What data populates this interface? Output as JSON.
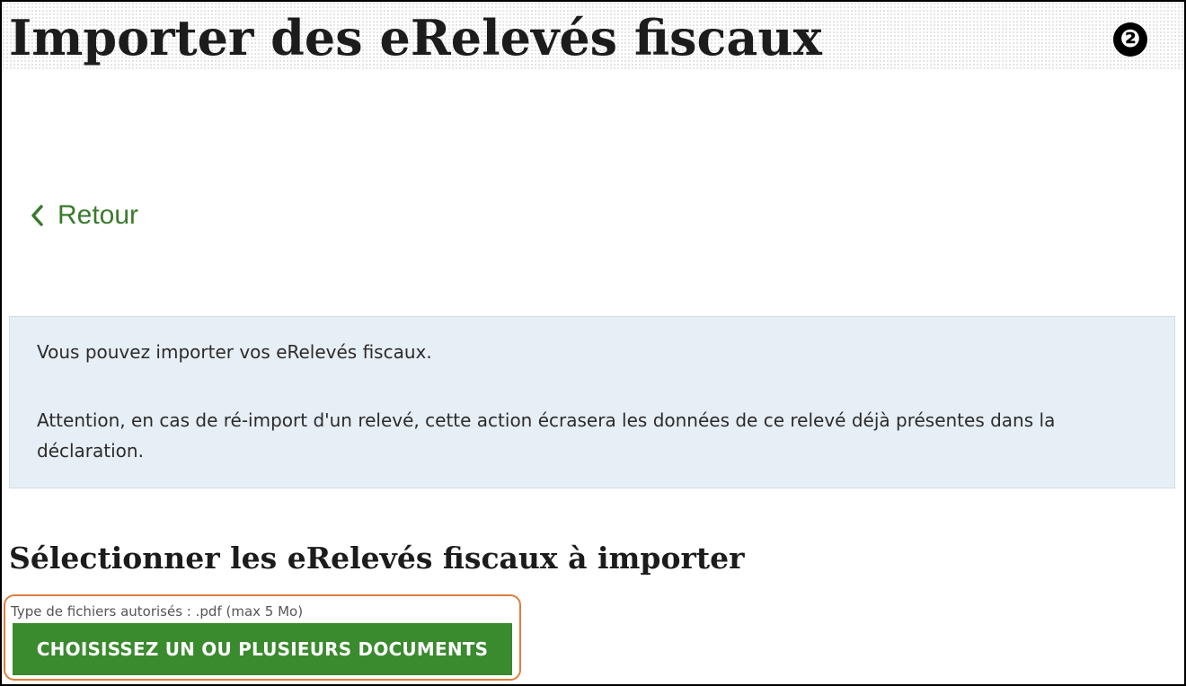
{
  "header": {
    "title": "Importer des eRelevés fiscaux",
    "step_badge": "❷"
  },
  "nav": {
    "back_label": "Retour",
    "back_icon": "chevron-left-icon",
    "accent_color": "#3a7a2c"
  },
  "info": {
    "paragraph_1": "Vous pouvez importer vos eRelevés fiscaux.",
    "paragraph_2": "Attention, en cas de ré-import d'un relevé, cette action écrasera les données de ce relevé déjà présentes dans la déclaration.",
    "background_color": "#e7eff6"
  },
  "upload": {
    "section_title": "Sélectionner les eRelevés fiscaux à importer",
    "file_hint": "Type de fichiers autorisés : .pdf (max 5 Mo)",
    "button_label": "CHOISISSEZ UN OU PLUSIEURS DOCUMENTS",
    "button_color": "#3a8a2e",
    "highlight_color": "#e07d3a"
  }
}
